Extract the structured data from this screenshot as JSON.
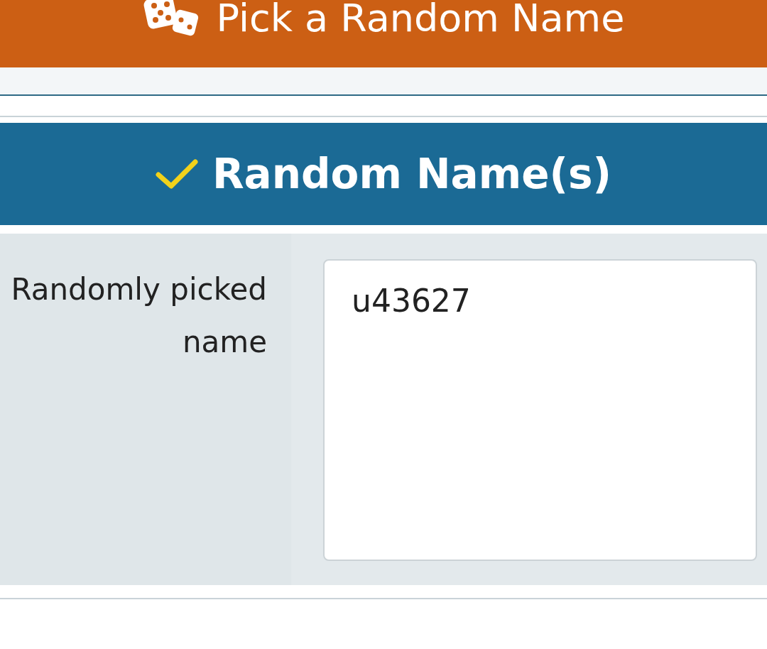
{
  "header": {
    "title": "Pick a Random Name"
  },
  "result_panel": {
    "title": "Random Name(s)",
    "label": "Randomly picked name",
    "value": "u43627"
  }
}
